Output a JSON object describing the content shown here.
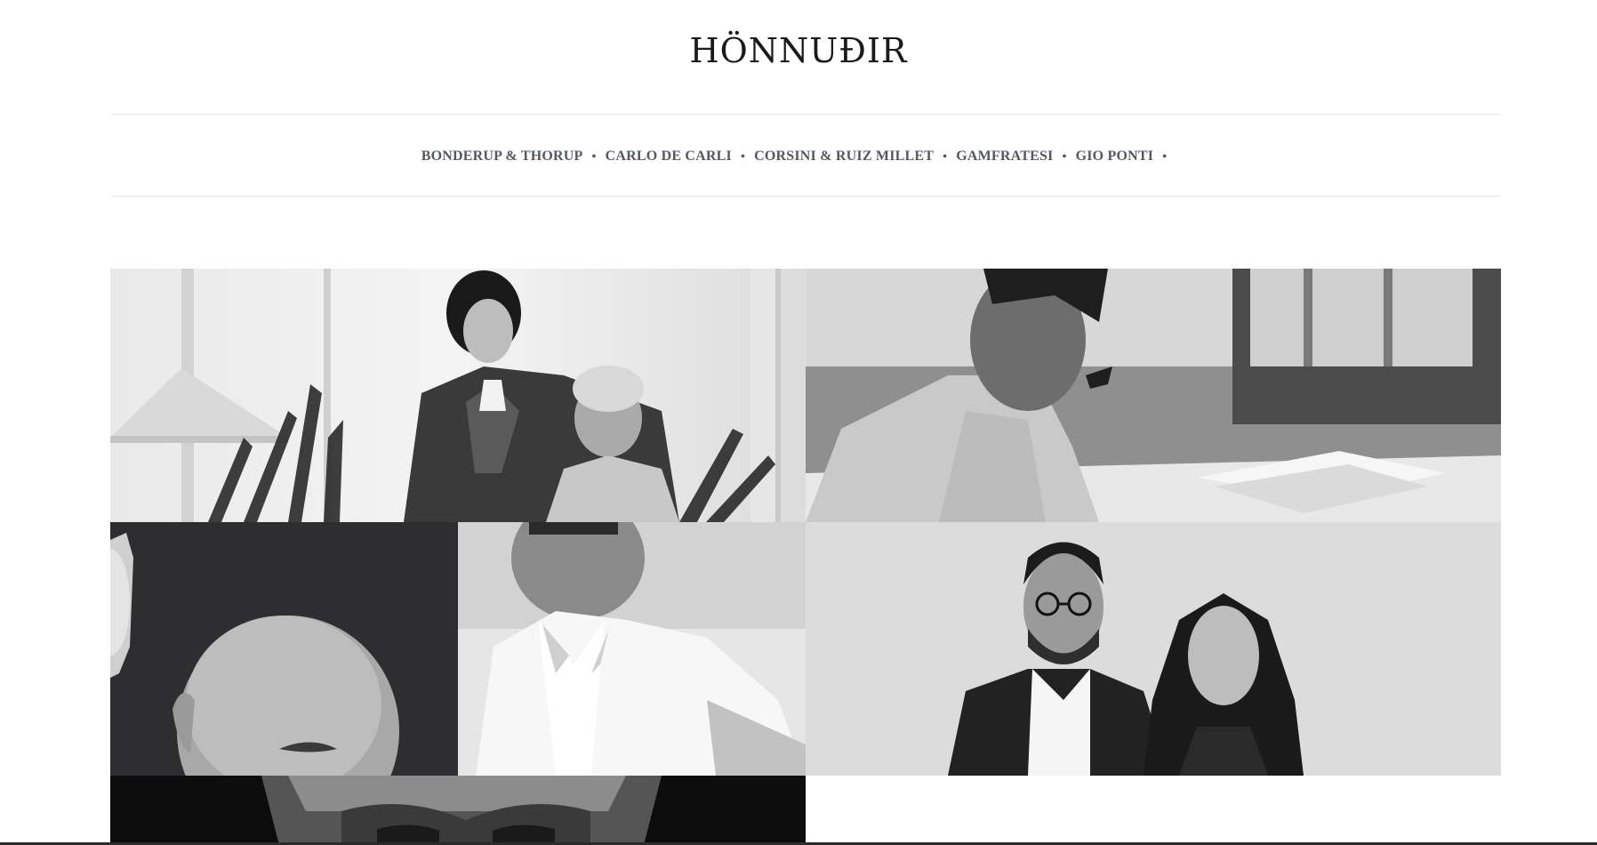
{
  "header": {
    "title": "HÖNNUÐIR"
  },
  "nav": {
    "items": [
      "BONDERUP & THORUP",
      "CARLO DE CARLI",
      "CORSINI & RUIZ MILLET",
      "GAMFRATESI",
      "GIO PONTI"
    ],
    "separator": "•"
  },
  "gallery": {
    "tiles": [
      {
        "icon": "photo-bonderup-thorup"
      },
      {
        "icon": "photo-carlo-de-carli"
      },
      {
        "icon": "photo-corsini"
      },
      {
        "icon": "photo-ruiz-millet"
      },
      {
        "icon": "photo-gamfratesi"
      },
      {
        "icon": "photo-gio-ponti"
      }
    ]
  },
  "colors": {
    "nav_text": "#55595f",
    "title_text": "#1a1a1a",
    "rule": "#e6e6e6"
  }
}
